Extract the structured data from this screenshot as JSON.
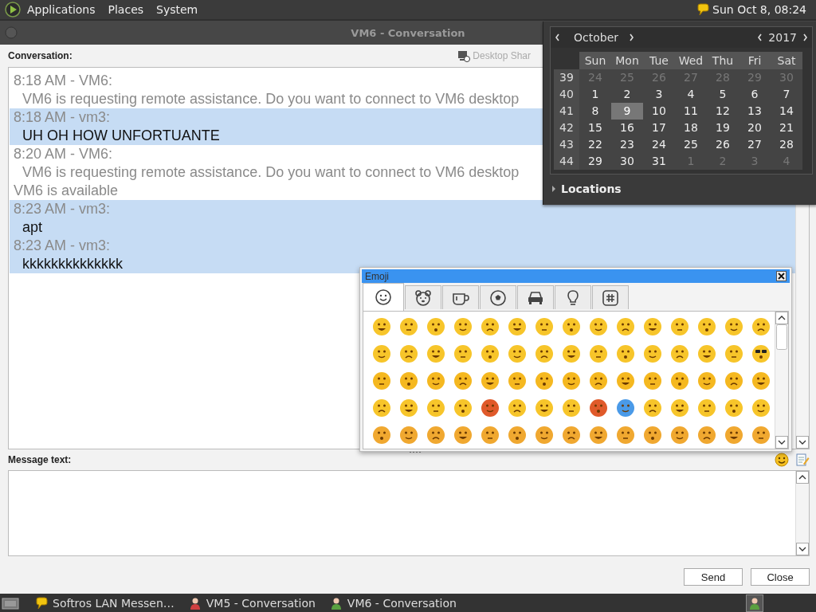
{
  "top_panel": {
    "menus": [
      "Applications",
      "Places",
      "System"
    ],
    "clock": "Sun Oct  8, 08:24"
  },
  "window": {
    "title": "VM6 - Conversation"
  },
  "conversation": {
    "label": "Conversation:",
    "desktop_sharing": "Desktop Shar",
    "entries": [
      {
        "kind": "message",
        "header": "8:18 AM - VM6:",
        "text": "VM6 is requesting remote assistance. Do you want to connect to VM6 desktop",
        "selected": false,
        "muted": true
      },
      {
        "kind": "message",
        "header": "8:18 AM - vm3:",
        "text": "UH OH HOW UNFORTUANTE",
        "selected": true,
        "muted": false
      },
      {
        "kind": "message",
        "header": "8:20 AM - VM6:",
        "text": "VM6 is requesting remote assistance. Do you want to connect to VM6 desktop",
        "selected": false,
        "muted": true
      },
      {
        "kind": "notice",
        "text": "VM6 is available",
        "selected": false,
        "muted": true
      },
      {
        "kind": "message",
        "header": "8:23 AM - vm3:",
        "text": "apt",
        "selected": true,
        "muted": false
      },
      {
        "kind": "message",
        "header": "8:23 AM - vm3:",
        "text": "kkkkkkkkkkkkkk",
        "selected": true,
        "muted": false
      }
    ]
  },
  "message": {
    "label": "Message text:"
  },
  "buttons": [
    "Send",
    "Close"
  ],
  "calendar": {
    "month": "October",
    "year": "2017",
    "weekdays": [
      "Sun",
      "Mon",
      "Tue",
      "Wed",
      "Thu",
      "Fri",
      "Sat"
    ],
    "weeks": [
      {
        "number": "39",
        "days": [
          {
            "label": "24",
            "other_month": true,
            "selected": false
          },
          {
            "label": "25",
            "other_month": true,
            "selected": false
          },
          {
            "label": "26",
            "other_month": true,
            "selected": false
          },
          {
            "label": "27",
            "other_month": true,
            "selected": false
          },
          {
            "label": "28",
            "other_month": true,
            "selected": false
          },
          {
            "label": "29",
            "other_month": true,
            "selected": false
          },
          {
            "label": "30",
            "other_month": true,
            "selected": false
          }
        ]
      },
      {
        "number": "40",
        "days": [
          {
            "label": "1",
            "other_month": false,
            "selected": false
          },
          {
            "label": "2",
            "other_month": false,
            "selected": false
          },
          {
            "label": "3",
            "other_month": false,
            "selected": false
          },
          {
            "label": "4",
            "other_month": false,
            "selected": false
          },
          {
            "label": "5",
            "other_month": false,
            "selected": false
          },
          {
            "label": "6",
            "other_month": false,
            "selected": false
          },
          {
            "label": "7",
            "other_month": false,
            "selected": false
          }
        ]
      },
      {
        "number": "41",
        "days": [
          {
            "label": "8",
            "other_month": false,
            "selected": false
          },
          {
            "label": "9",
            "other_month": false,
            "selected": true
          },
          {
            "label": "10",
            "other_month": false,
            "selected": false
          },
          {
            "label": "11",
            "other_month": false,
            "selected": false
          },
          {
            "label": "12",
            "other_month": false,
            "selected": false
          },
          {
            "label": "13",
            "other_month": false,
            "selected": false
          },
          {
            "label": "14",
            "other_month": false,
            "selected": false
          }
        ]
      },
      {
        "number": "42",
        "days": [
          {
            "label": "15",
            "other_month": false,
            "selected": false
          },
          {
            "label": "16",
            "other_month": false,
            "selected": false
          },
          {
            "label": "17",
            "other_month": false,
            "selected": false
          },
          {
            "label": "18",
            "other_month": false,
            "selected": false
          },
          {
            "label": "19",
            "other_month": false,
            "selected": false
          },
          {
            "label": "20",
            "other_month": false,
            "selected": false
          },
          {
            "label": "21",
            "other_month": false,
            "selected": false
          }
        ]
      },
      {
        "number": "43",
        "days": [
          {
            "label": "22",
            "other_month": false,
            "selected": false
          },
          {
            "label": "23",
            "other_month": false,
            "selected": false
          },
          {
            "label": "24",
            "other_month": false,
            "selected": false
          },
          {
            "label": "25",
            "other_month": false,
            "selected": false
          },
          {
            "label": "26",
            "other_month": false,
            "selected": false
          },
          {
            "label": "27",
            "other_month": false,
            "selected": false
          },
          {
            "label": "28",
            "other_month": false,
            "selected": false
          }
        ]
      },
      {
        "number": "44",
        "days": [
          {
            "label": "29",
            "other_month": false,
            "selected": false
          },
          {
            "label": "30",
            "other_month": false,
            "selected": false
          },
          {
            "label": "31",
            "other_month": false,
            "selected": false
          },
          {
            "label": "1",
            "other_month": true,
            "selected": false
          },
          {
            "label": "2",
            "other_month": true,
            "selected": false
          },
          {
            "label": "3",
            "other_month": true,
            "selected": false
          },
          {
            "label": "4",
            "other_month": true,
            "selected": false
          }
        ]
      }
    ],
    "locations": {
      "label": "Locations",
      "expanded": false
    }
  },
  "emoji_picker": {
    "title": "Emoji",
    "tabs": [
      {
        "selected": true
      },
      {
        "selected": false
      },
      {
        "selected": false
      },
      {
        "selected": false
      },
      {
        "selected": false
      },
      {
        "selected": false
      },
      {
        "selected": false
      }
    ]
  },
  "taskbar": {
    "tasks": [
      {
        "label": "Softros LAN Messen…",
        "kind": "messenger"
      },
      {
        "label": "VM5 - Conversation",
        "kind": "user_red"
      },
      {
        "label": "VM6 - Conversation",
        "kind": "user_green"
      }
    ]
  }
}
